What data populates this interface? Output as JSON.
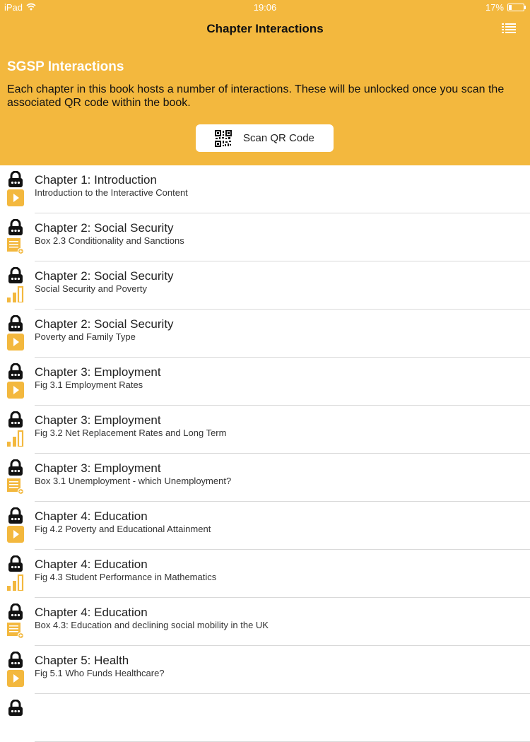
{
  "status_bar": {
    "device": "iPad",
    "time": "19:06",
    "battery": "17%"
  },
  "nav": {
    "title": "Chapter Interactions",
    "menu_icon": "list-icon"
  },
  "header": {
    "title": "SGSP Interactions",
    "description": "Each chapter in this book hosts a number of interactions. These will be unlocked once you scan the associated QR code within the book.",
    "scan_button": "Scan QR Code"
  },
  "colors": {
    "accent": "#f3b83e",
    "icon_yellow": "#f3b83e",
    "lock": "#111111"
  },
  "items": [
    {
      "title": "Chapter 1: Introduction",
      "subtitle": "Introduction to the Interactive Content",
      "type": "video"
    },
    {
      "title": "Chapter 2: Social Security",
      "subtitle": "Box 2.3 Conditionality and Sanctions",
      "type": "text"
    },
    {
      "title": "Chapter 2: Social Security",
      "subtitle": "Social Security and Poverty",
      "type": "chart"
    },
    {
      "title": "Chapter 2: Social Security",
      "subtitle": "Poverty and Family Type",
      "type": "video"
    },
    {
      "title": "Chapter 3: Employment",
      "subtitle": "Fig 3.1 Employment Rates",
      "type": "video"
    },
    {
      "title": "Chapter 3: Employment",
      "subtitle": "Fig 3.2 Net Replacement Rates and Long Term",
      "type": "chart"
    },
    {
      "title": "Chapter 3: Employment",
      "subtitle": "Box 3.1 Unemployment - which Unemployment?",
      "type": "text"
    },
    {
      "title": "Chapter 4: Education",
      "subtitle": "Fig 4.2 Poverty and Educational Attainment",
      "type": "video"
    },
    {
      "title": "Chapter 4: Education",
      "subtitle": "Fig 4.3 Student Performance in Mathematics",
      "type": "chart"
    },
    {
      "title": "Chapter 4: Education",
      "subtitle": "Box 4.3: Education and declining social mobility in the UK",
      "type": "text"
    },
    {
      "title": "Chapter 5: Health",
      "subtitle": "Fig 5.1 Who Funds Healthcare?",
      "type": "video"
    },
    {
      "title": "",
      "subtitle": "",
      "type": "none"
    }
  ]
}
